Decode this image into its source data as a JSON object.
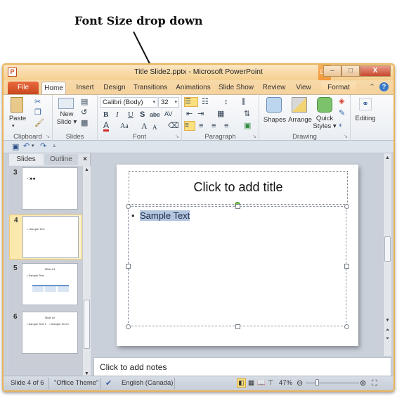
{
  "annotation": {
    "label": "Font Size drop down"
  },
  "window": {
    "app_icon": "P",
    "title": "Title Slide2.pptx - Microsoft PowerPoint",
    "context_tab": "D...",
    "controls": {
      "minimize": "–",
      "maximize": "□",
      "close": "X"
    }
  },
  "tabs": [
    "File",
    "Home",
    "Insert",
    "Design",
    "Transitions",
    "Animations",
    "Slide Show",
    "Review",
    "View",
    "Format"
  ],
  "tab_icons": {
    "minimize_ribbon": "⌃",
    "help": "?"
  },
  "ribbon": {
    "clipboard": {
      "paste": "Paste",
      "label": "Clipboard"
    },
    "slides": {
      "new_slide_line1": "New",
      "new_slide_line2": "Slide ▾",
      "label": "Slides"
    },
    "font": {
      "font_name": "Calibri (Body)",
      "font_size": "32",
      "bold": "B",
      "italic": "I",
      "underline": "U",
      "shadow": "S",
      "strikethrough": "abc",
      "spacing": "AV",
      "font_color": "A",
      "change_case": "Aa",
      "grow": "A",
      "shrink": "A",
      "label": "Font"
    },
    "paragraph": {
      "label": "Paragraph"
    },
    "drawing": {
      "shapes": "Shapes",
      "arrange": "Arrange",
      "quick_styles_line1": "Quick",
      "quick_styles_line2": "Styles ▾",
      "label": "Drawing"
    },
    "editing": {
      "label": "Editing"
    }
  },
  "left_pane": {
    "tabs": [
      "Slides",
      "Outline"
    ],
    "close": "×",
    "thumbnails": [
      {
        "number": "3",
        "title": "",
        "text": "-:●●"
      },
      {
        "number": "4",
        "title": "",
        "text": "• Sample Text",
        "selected": true
      },
      {
        "number": "5",
        "title": "Slide #1",
        "text": "• Sample Text"
      },
      {
        "number": "6",
        "title": "Slide #2",
        "text": "• Sample Text 1    • Sample Text 2"
      }
    ]
  },
  "slide": {
    "title_placeholder": "Click to add title",
    "bullet": "•",
    "body_text": "Sample Text"
  },
  "notes": {
    "placeholder": "Click to add notes"
  },
  "status": {
    "slide_info": "Slide 4 of 6",
    "theme": "\"Office Theme\"",
    "language": "English (Canada)",
    "zoom": "47%",
    "zoom_fraction": 0.47
  }
}
